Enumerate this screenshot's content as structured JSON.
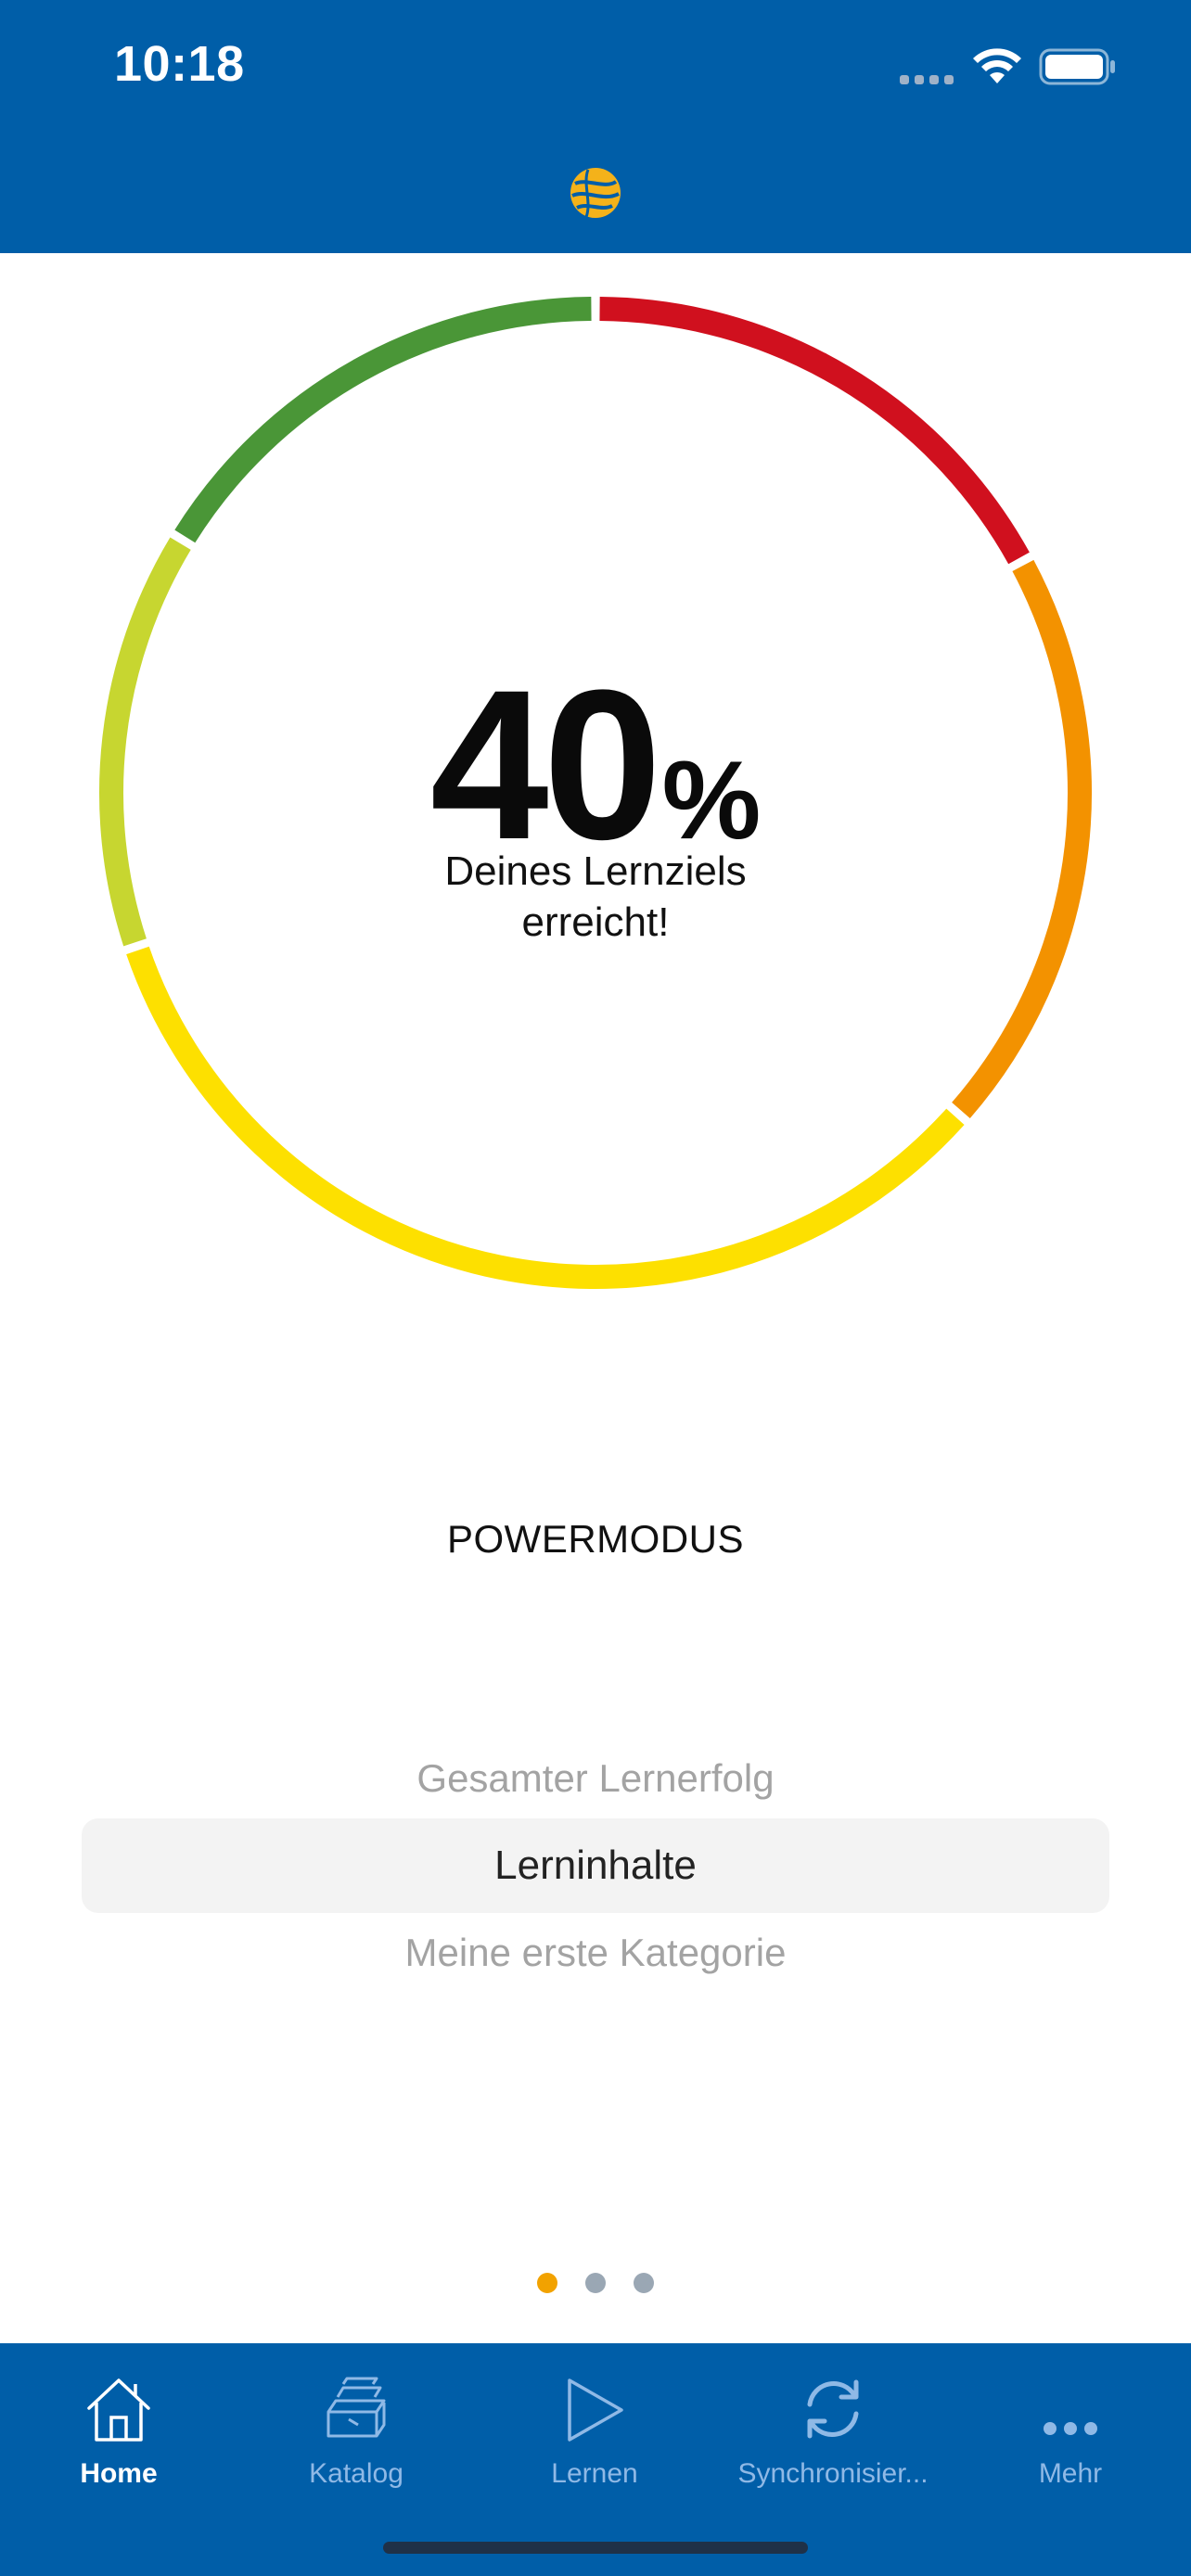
{
  "status_bar": {
    "time": "10:18"
  },
  "progress": {
    "value": 40,
    "number": "40",
    "unit": "%",
    "caption_line1": "Deines Lernziels",
    "caption_line2": "erreicht!",
    "segment_colors": [
      "#d0101e",
      "#f39200",
      "#fde000",
      "#c7d630",
      "#4a9637"
    ]
  },
  "mode": {
    "label": "POWERMODUS"
  },
  "picker": {
    "options": [
      "Gesamter Lernerfolg",
      "Lerninhalte",
      "Meine erste Kategorie"
    ],
    "selected": "Lerninhalte"
  },
  "pager": {
    "count": 3,
    "active_index": 0
  },
  "tabbar": {
    "items": [
      {
        "label": "Home",
        "icon": "home-icon",
        "active": true
      },
      {
        "label": "Katalog",
        "icon": "catalog-icon",
        "active": false
      },
      {
        "label": "Lernen",
        "icon": "play-icon",
        "active": false
      },
      {
        "label": "Synchronisier...",
        "icon": "sync-icon",
        "active": false
      },
      {
        "label": "Mehr",
        "icon": "more-icon",
        "active": false
      }
    ]
  },
  "colors": {
    "brand_blue": "#005ea8",
    "accent_orange": "#f2a200",
    "tab_inactive": "#8fb9e6"
  }
}
